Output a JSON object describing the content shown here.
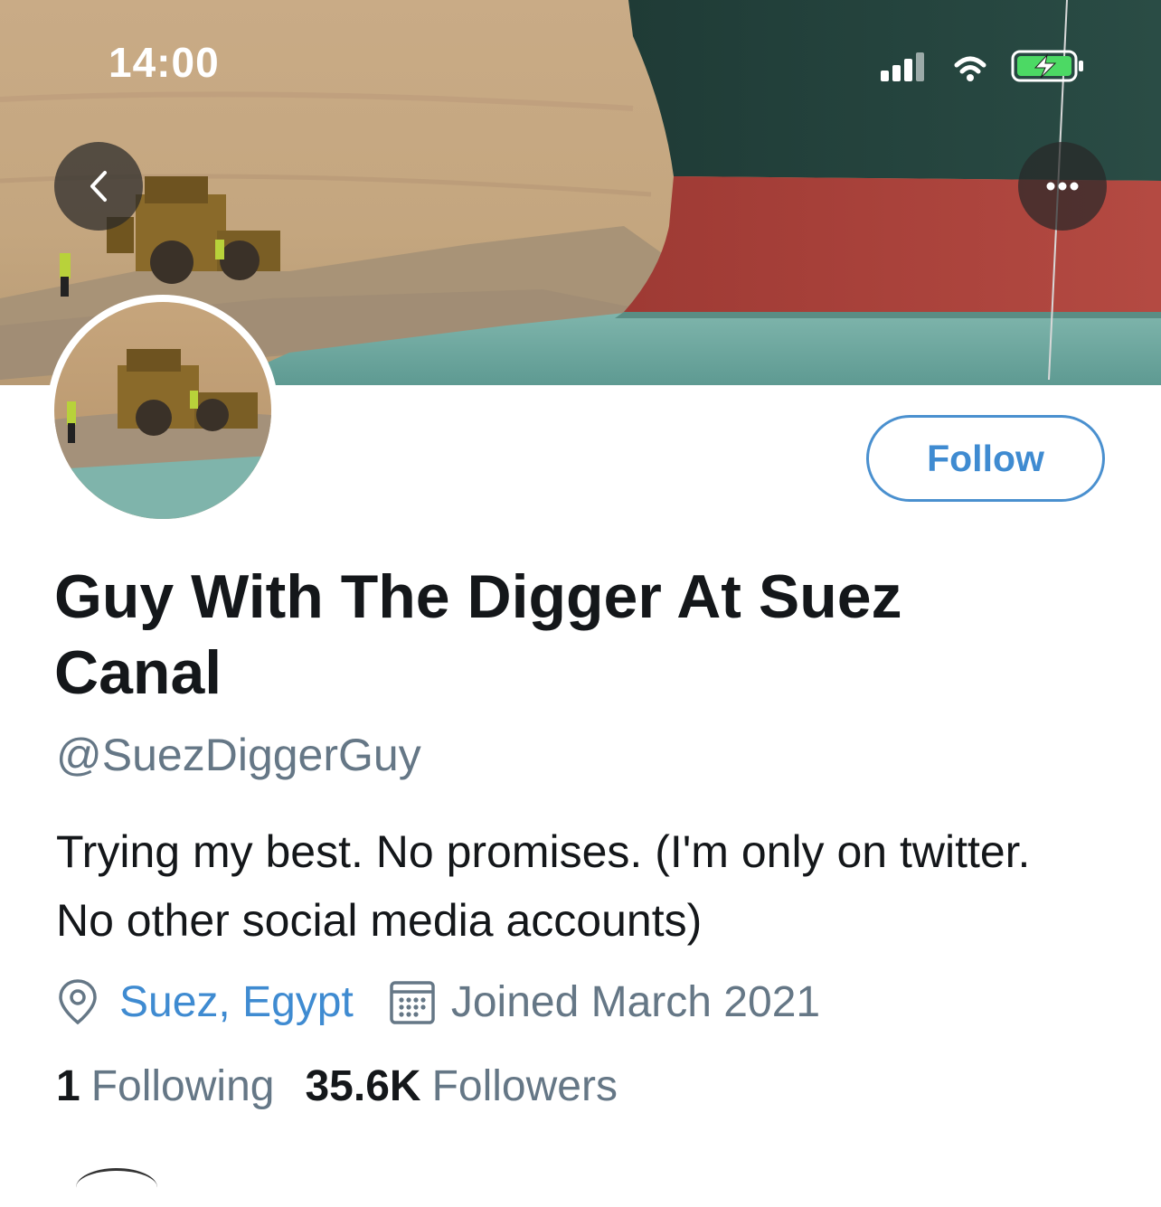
{
  "status_bar": {
    "time": "14:00",
    "icons": [
      "signal-icon",
      "wifi-icon",
      "battery-charging-icon"
    ]
  },
  "header": {
    "back_icon": "chevron-left-icon",
    "more_icon": "more-horizontal-icon",
    "banner_image": "bulldozer beside container ship in canal"
  },
  "profile": {
    "display_name": "Guy With The Digger At Suez Canal",
    "handle": "@SuezDiggerGuy",
    "bio": "Trying my best. No promises. (I'm only on twitter. No other social media accounts)",
    "location": "Suez, Egypt",
    "joined": "Joined March 2021",
    "following_count": "1",
    "following_label": "Following",
    "followers_count": "35.6K",
    "followers_label": "Followers"
  },
  "actions": {
    "follow_label": "Follow"
  },
  "colors": {
    "accent": "#3f8bd1",
    "secondary_text": "#657786",
    "primary_text": "#14171a"
  }
}
